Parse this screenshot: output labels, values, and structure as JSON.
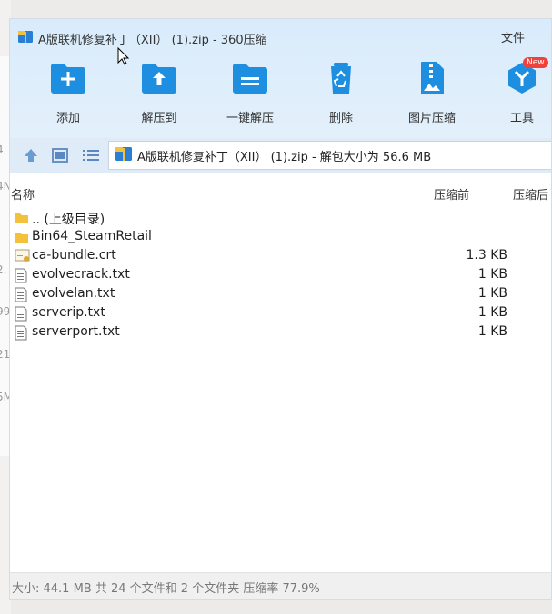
{
  "window": {
    "title": "A版联机修复补丁（XII） (1).zip - 360压缩",
    "file_menu": "文件"
  },
  "toolbar": [
    {
      "label": "添加",
      "icon": "folder-add-icon"
    },
    {
      "label": "解压到",
      "icon": "folder-extract-icon"
    },
    {
      "label": "一键解压",
      "icon": "one-click-extract-icon"
    },
    {
      "label": "删除",
      "icon": "recycle-bin-icon"
    },
    {
      "label": "图片压缩",
      "icon": "image-compress-icon"
    },
    {
      "label": "工具",
      "icon": "tools-icon",
      "badge": "New"
    }
  ],
  "address": {
    "text": "A版联机修复补丁（XII） (1).zip - 解包大小为 56.6 MB"
  },
  "columns": {
    "name": "名称",
    "before": "压缩前",
    "after": "压缩后"
  },
  "files": [
    {
      "name": ".. (上级目录)",
      "size": "",
      "type": "folder"
    },
    {
      "name": "Bin64_SteamRetail",
      "size": "",
      "type": "folder"
    },
    {
      "name": "ca-bundle.crt",
      "size": "1.3 KB",
      "type": "certificate"
    },
    {
      "name": "evolvecrack.txt",
      "size": "1 KB",
      "type": "text"
    },
    {
      "name": "evolvelan.txt",
      "size": "1 KB",
      "type": "text"
    },
    {
      "name": "serverip.txt",
      "size": "1 KB",
      "type": "text"
    },
    {
      "name": "serverport.txt",
      "size": "1 KB",
      "type": "text"
    }
  ],
  "status": "大小: 44.1 MB 共 24 个文件和 2 个文件夹 压缩率 77.9%",
  "background_fragments": [
    "4",
    "4N",
    "2.",
    "99",
    "21",
    "5M"
  ],
  "colors": {
    "accent": "#1e8fe0",
    "header_bg": "#dcecfa",
    "folder": "#f4c13c",
    "badge": "#f0423a"
  }
}
